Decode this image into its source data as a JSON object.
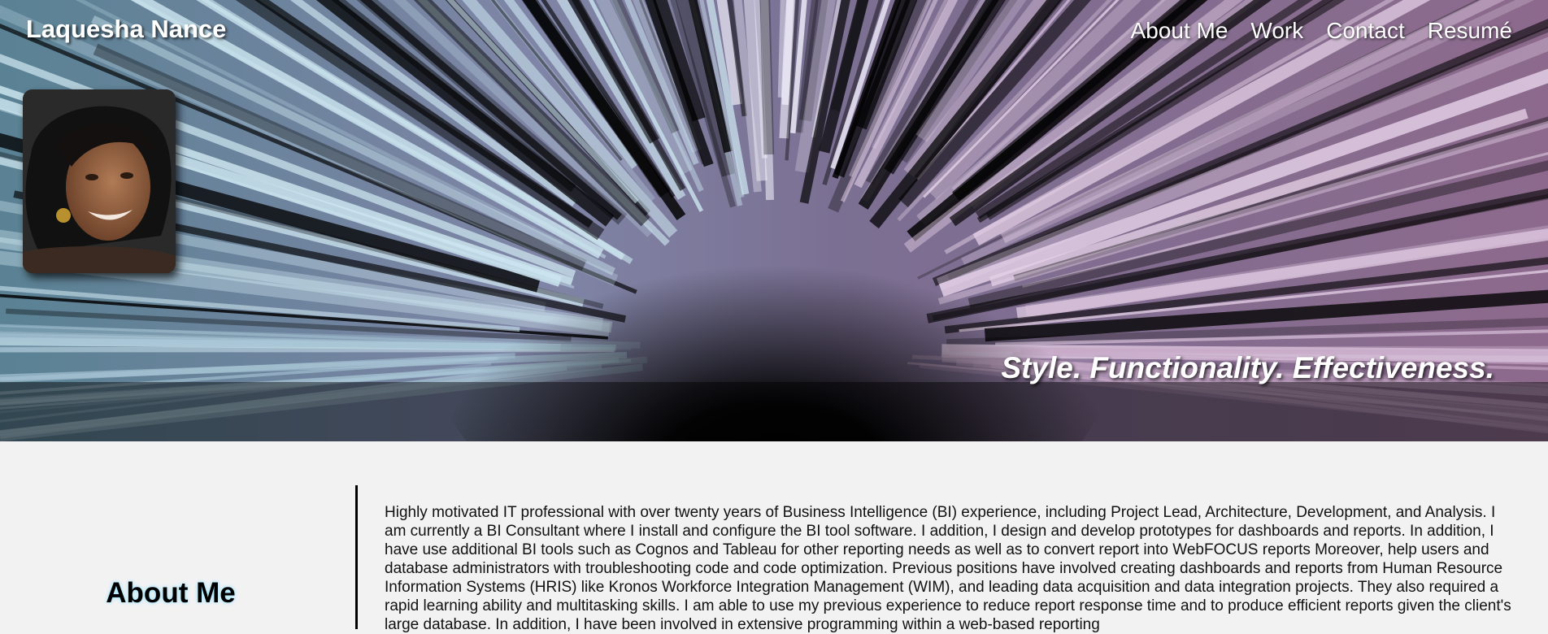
{
  "header": {
    "site_name": "Laquesha Nance",
    "nav": [
      {
        "label": "About Me"
      },
      {
        "label": "Work"
      },
      {
        "label": "Contact"
      },
      {
        "label": "Resumé"
      }
    ],
    "tagline": "Style. Functionality. Effectiveness."
  },
  "about": {
    "heading": "About Me",
    "bio": "Highly motivated IT professional with over twenty years of Business Intelligence (BI) experience, including Project Lead, Architecture, Development, and Analysis. I am currently a BI Consultant where I install and configure the BI tool software. I addition, I design and develop prototypes for dashboards and reports. In addition, I have use additional BI tools such as Cognos and Tableau for other reporting needs as well as to convert report into WebFOCUS reports Moreover, help users and database administrators with troubleshooting code and code optimization. Previous positions have involved creating dashboards and reports from Human Resource Information Systems (HRIS) like Kronos Workforce Integration Management (WIM), and leading data acquisition and data integration projects. They also required a rapid learning ability and multitasking skills. I am able to use my previous experience to reduce report response time and to produce efficient reports given the client's large database. In addition, I have been involved in extensive programming within a web-based reporting"
  },
  "colors": {
    "page_background": "#f3f2f3",
    "hero_left": "#8fb4c4",
    "hero_right": "#a886a8",
    "heading_glow": "#9fe7ff"
  }
}
